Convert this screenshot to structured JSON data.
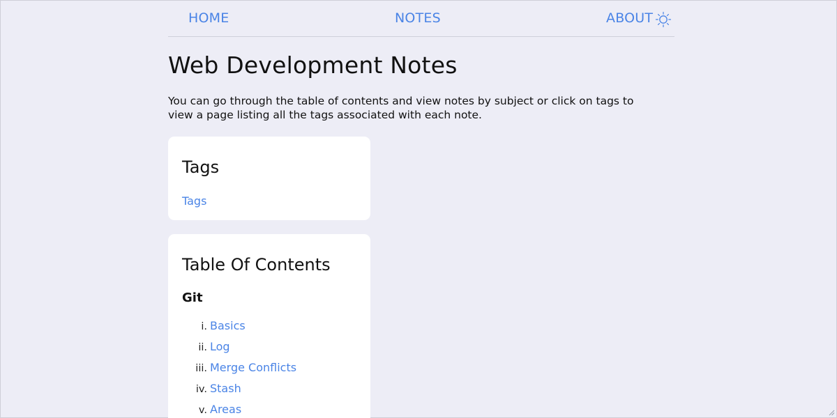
{
  "nav": {
    "home": "HOME",
    "notes": "NOTES",
    "about": "ABOUT",
    "theme_icon": "sun-icon"
  },
  "page": {
    "title": "Web Development Notes",
    "intro": "You can go through the table of contents and view notes by subject or click on tags to view a page listing all the tags associated with each note."
  },
  "tags_card": {
    "title": "Tags",
    "link": "Tags"
  },
  "toc_card": {
    "title": "Table Of Contents",
    "section_title": "Git",
    "items": [
      {
        "num": "i.",
        "label": "Basics"
      },
      {
        "num": "ii.",
        "label": "Log"
      },
      {
        "num": "iii.",
        "label": "Merge Conflicts"
      },
      {
        "num": "iv.",
        "label": "Stash"
      },
      {
        "num": "v.",
        "label": "Areas"
      }
    ]
  },
  "colors": {
    "background": "#ededf6",
    "link": "#4a84e6",
    "card": "#ffffff",
    "text": "#111111"
  }
}
